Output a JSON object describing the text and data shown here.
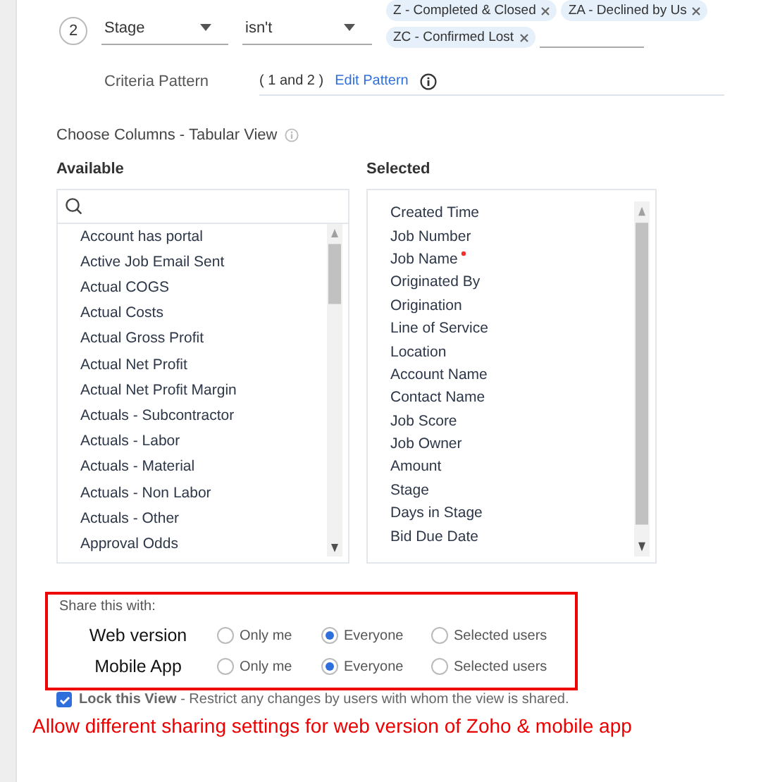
{
  "criteria_row": {
    "number": "2",
    "field": "Stage",
    "operator": "isn't",
    "values": [
      "Z - Completed & Closed",
      "ZA - Declined by Us",
      "ZC - Confirmed Lost"
    ]
  },
  "criteria_pattern": {
    "label": "Criteria Pattern",
    "value": "( 1 and 2 )",
    "link": "Edit Pattern"
  },
  "choose_columns": {
    "title": "Choose Columns - Tabular View",
    "available": {
      "label": "Available",
      "items": [
        "Account has portal",
        "Active Job Email Sent",
        "Actual COGS",
        "Actual Costs",
        "Actual Gross Profit",
        "Actual Net Profit",
        "Actual Net Profit Margin",
        "Actuals - Subcontractor",
        "Actuals - Labor",
        "Actuals - Material",
        "Actuals - Non Labor",
        "Actuals - Other",
        "Approval Odds"
      ]
    },
    "selected": {
      "label": "Selected",
      "items": [
        {
          "text": "Created Time",
          "required": false
        },
        {
          "text": "Job Number",
          "required": false
        },
        {
          "text": "Job Name",
          "required": true
        },
        {
          "text": "Originated By",
          "required": false
        },
        {
          "text": "Origination",
          "required": false
        },
        {
          "text": "Line of Service",
          "required": false
        },
        {
          "text": "Location",
          "required": false
        },
        {
          "text": "Account Name",
          "required": false
        },
        {
          "text": "Contact Name",
          "required": false
        },
        {
          "text": "Job Score",
          "required": false
        },
        {
          "text": "Job Owner",
          "required": false
        },
        {
          "text": "Amount",
          "required": false
        },
        {
          "text": "Stage",
          "required": false
        },
        {
          "text": "Days in Stage",
          "required": false
        },
        {
          "text": "Bid Due Date",
          "required": false
        }
      ]
    }
  },
  "share": {
    "title": "Share this with:",
    "rows": [
      {
        "label": "Web version",
        "options": [
          {
            "label": "Only me",
            "selected": false
          },
          {
            "label": "Everyone",
            "selected": true
          },
          {
            "label": "Selected users",
            "selected": false
          }
        ]
      },
      {
        "label": "Mobile App",
        "options": [
          {
            "label": "Only me",
            "selected": false
          },
          {
            "label": "Everyone",
            "selected": true
          },
          {
            "label": "Selected users",
            "selected": false
          }
        ]
      }
    ]
  },
  "lock_view": {
    "checked": true,
    "title": "Lock this View",
    "text": "- Restrict any changes by users with whom the view is shared."
  },
  "annotation": "Allow different sharing settings for web version of Zoho & mobile app"
}
